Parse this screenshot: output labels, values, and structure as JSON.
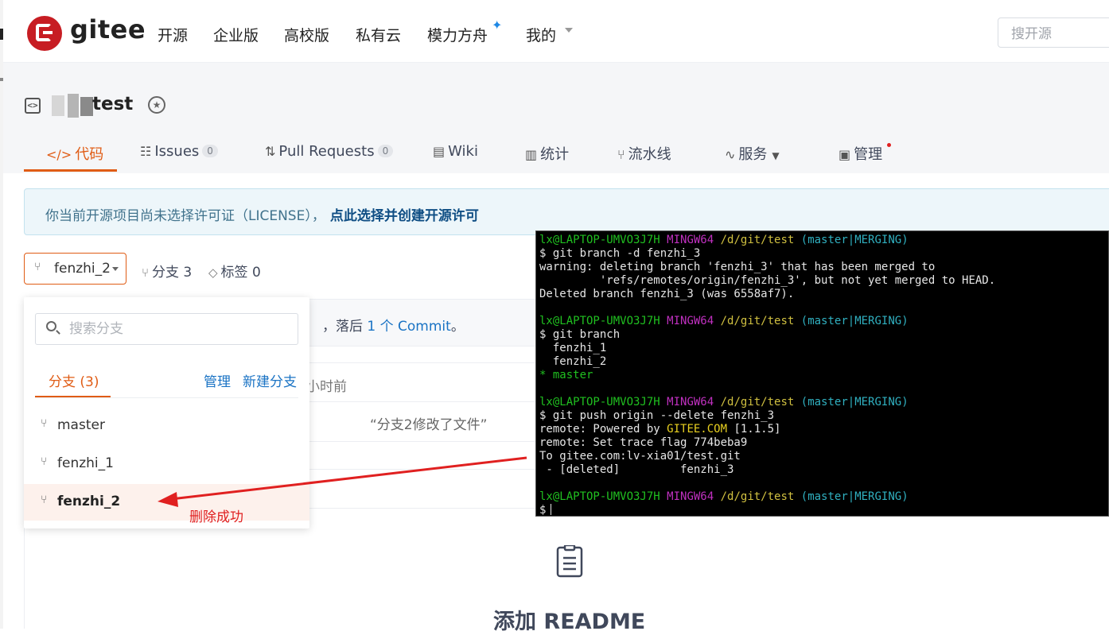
{
  "header": {
    "logo_text": "gitee",
    "nav": [
      "开源",
      "企业版",
      "高校版",
      "私有云",
      "模力方舟",
      "我的"
    ],
    "search_placeholder": "搜开源"
  },
  "repo": {
    "name": "test",
    "tabs": [
      {
        "label": "代码",
        "icon": "code-icon"
      },
      {
        "label": "Issues",
        "count": "0",
        "icon": "issues-icon"
      },
      {
        "label": "Pull Requests",
        "count": "0",
        "icon": "pull-request-icon"
      },
      {
        "label": "Wiki",
        "icon": "wiki-icon"
      },
      {
        "label": "统计",
        "icon": "stats-icon"
      },
      {
        "label": "流水线",
        "icon": "pipeline-icon"
      },
      {
        "label": "服务",
        "icon": "service-icon"
      },
      {
        "label": "管理",
        "icon": "manage-icon"
      }
    ]
  },
  "license": {
    "text": "你当前开源项目尚未选择许可证（LICENSE），",
    "link": "点此选择并创建开源许可"
  },
  "branch": {
    "current": "fenzhi_2",
    "branch_count_label": "分支 3",
    "tag_count_label": "标签 0"
  },
  "commit_info": {
    "prefix": "，落后 ",
    "link": "1 个 Commit",
    "suffix": "。",
    "time": "小时前",
    "message": "“分支2修改了文件”"
  },
  "dropdown": {
    "search_placeholder": "搜索分支",
    "tab": "分支 (3)",
    "manage": "管理",
    "new_branch": "新建分支",
    "items": [
      "master",
      "fenzhi_1",
      "fenzhi_2"
    ]
  },
  "annotation": "删除成功",
  "readme": {
    "title": "添加 README"
  },
  "terminal": {
    "prompt_user": "lx@LAPTOP-UMVO3J7H",
    "prompt_env": "MINGW64",
    "prompt_path": "/d/git/test",
    "prompt_branch": "(master|MERGING)",
    "lines": {
      "cmd1": "$ git branch -d fenzhi_3",
      "warn1": "warning: deleting branch 'fenzhi_3' that has been merged to",
      "warn2": "         'refs/remotes/origin/fenzhi_3', but not yet merged to HEAD.",
      "deleted": "Deleted branch fenzhi_3 (was 6558af7).",
      "cmd2": "$ git branch",
      "b1": "  fenzhi_1",
      "b2": "  fenzhi_2",
      "b3": "* master",
      "cmd3": "$ git push origin --delete fenzhi_3",
      "r1_pre": "remote: Powered by ",
      "r1_gitee": "GITEE.COM",
      "r1_post": " [1.1.5]",
      "r2": "remote: Set trace flag 774beba9",
      "r3": "To gitee.com:lv-xia01/test.git",
      "r4": " - [deleted]         fenzhi_3",
      "cmd4": "$"
    }
  },
  "colors": {
    "brand_red": "#c71d23",
    "accent_orange": "#e05c15",
    "link_blue": "#1a73c4",
    "annotation_red": "#e02020"
  }
}
